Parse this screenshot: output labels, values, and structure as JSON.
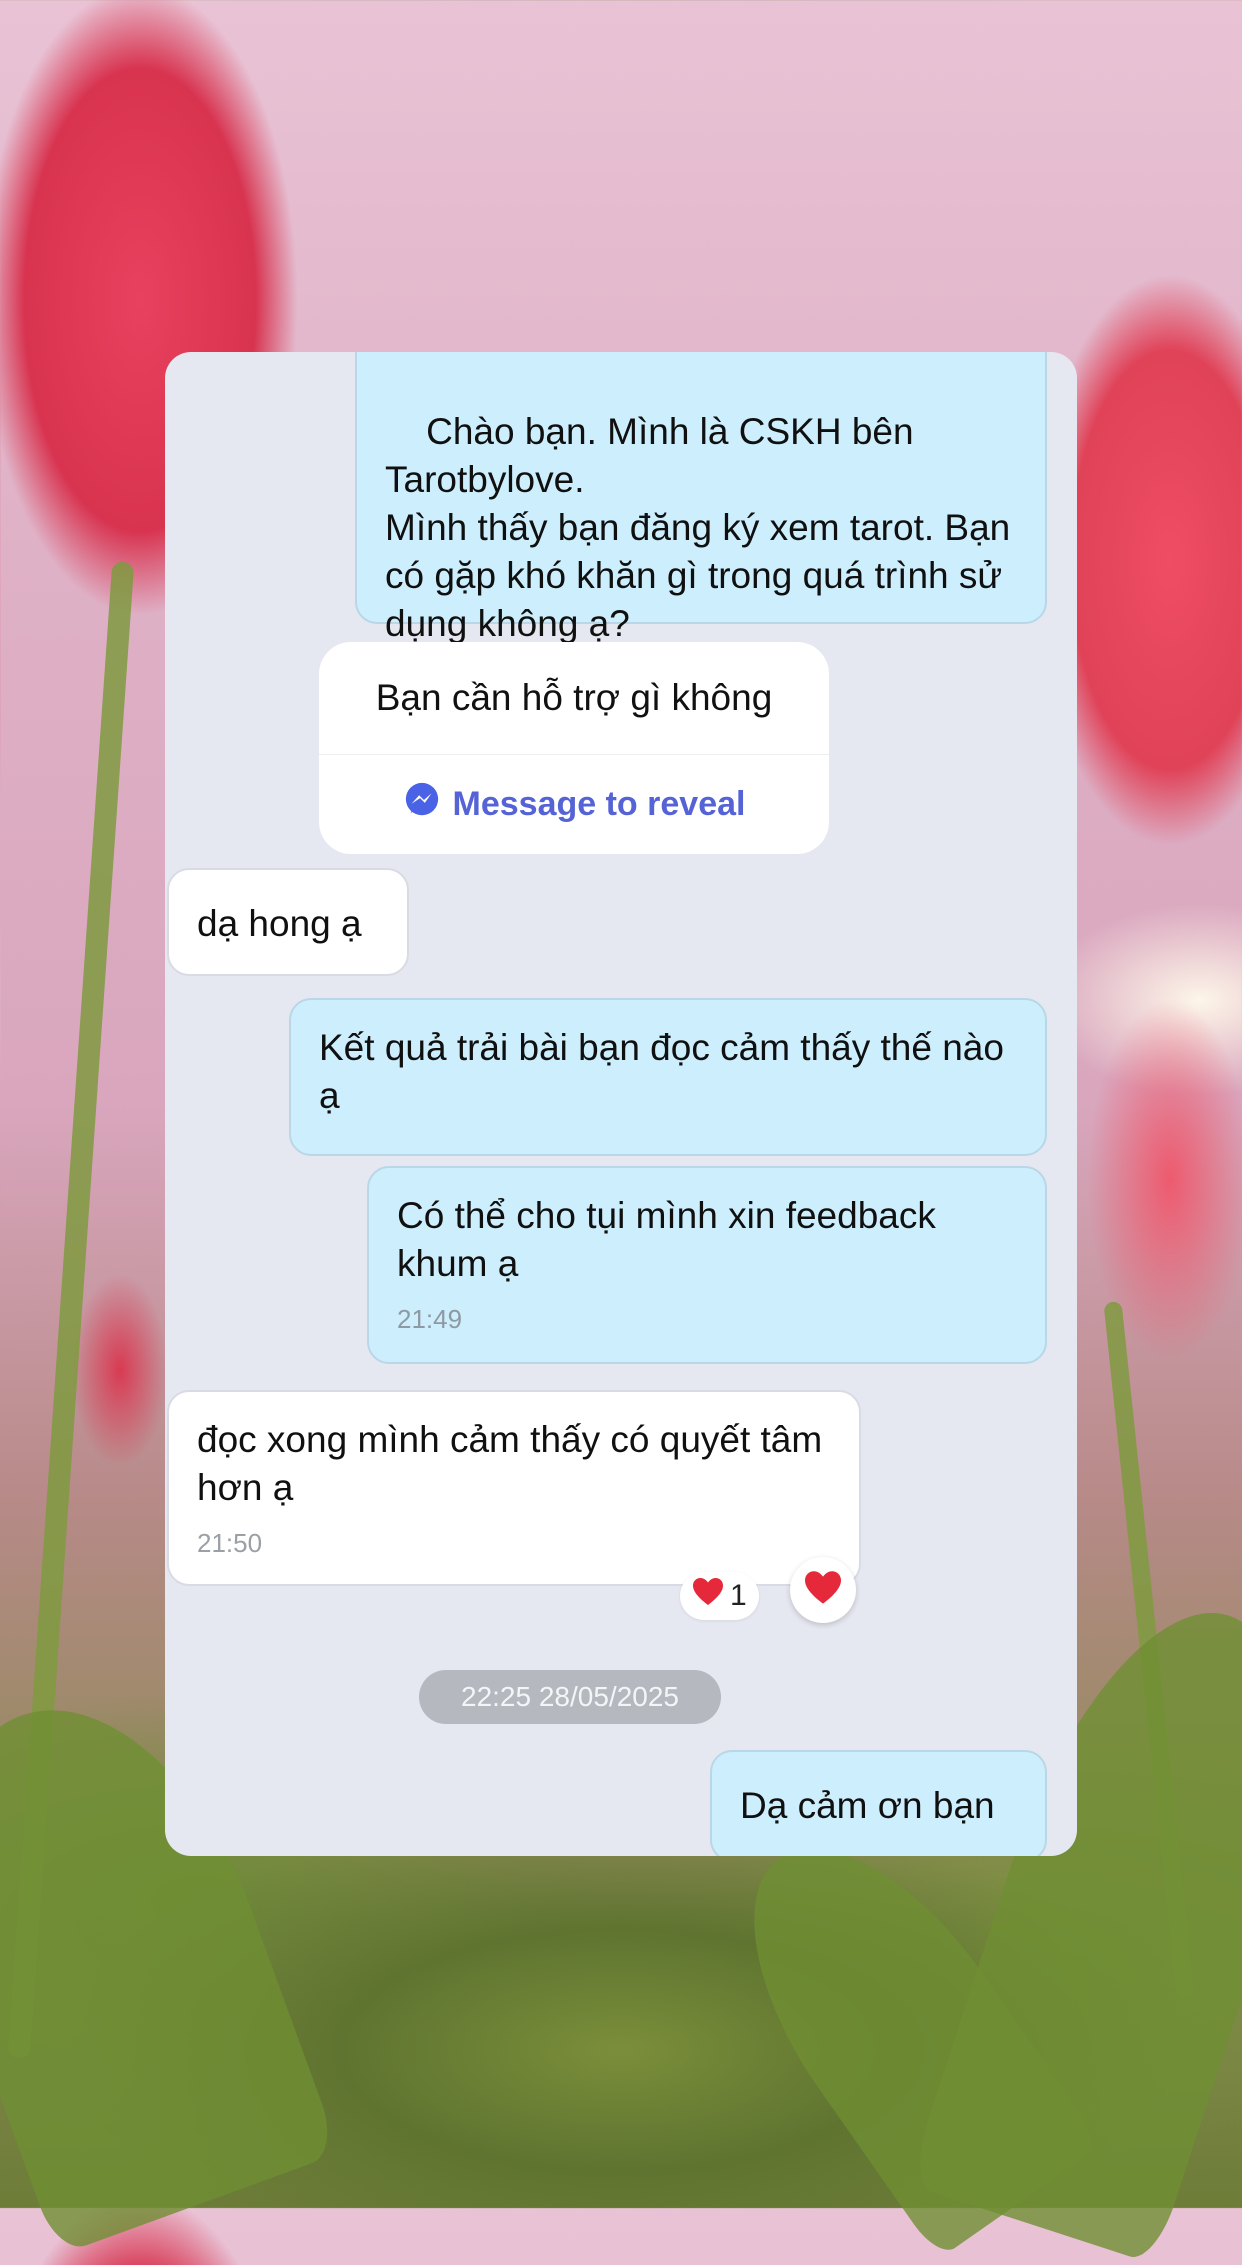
{
  "chat": {
    "messages": [
      {
        "direction": "out",
        "text": "Chào bạn. Mình là CSKH bên Tarotbylove.\nMình thấy bạn đăng ký xem tarot. Bạn có gặp khó khăn gì trong quá trình sử dụng không ạ?"
      },
      {
        "direction": "card",
        "title": "Bạn cần hỗ trợ gì không",
        "button": "Message to reveal"
      },
      {
        "direction": "in",
        "text": "dạ hong ạ"
      },
      {
        "direction": "out",
        "text": "Kết quả trải bài bạn đọc cảm thấy thế nào ạ"
      },
      {
        "direction": "out",
        "text": "Có thể cho tụi mình xin feedback khum ạ",
        "time": "21:49"
      },
      {
        "direction": "in",
        "text": "đọc xong mình cảm thấy có quyết tâm hơn ạ",
        "time": "21:50",
        "reaction": {
          "emoji": "❤️",
          "count": "1"
        }
      },
      {
        "direction": "out",
        "text": "Dạ cảm ơn bạn"
      }
    ],
    "date_separator": "22:25 28/05/2025"
  },
  "colors": {
    "outgoing_bubble": "#cdeefc",
    "incoming_bubble": "#ffffff",
    "chat_background": "#e6e8f1",
    "reveal_button": "#5563d6",
    "heart": "#e5283a"
  },
  "icons": {
    "reveal_icon": "messenger-icon",
    "reaction_icon": "heart-icon"
  }
}
